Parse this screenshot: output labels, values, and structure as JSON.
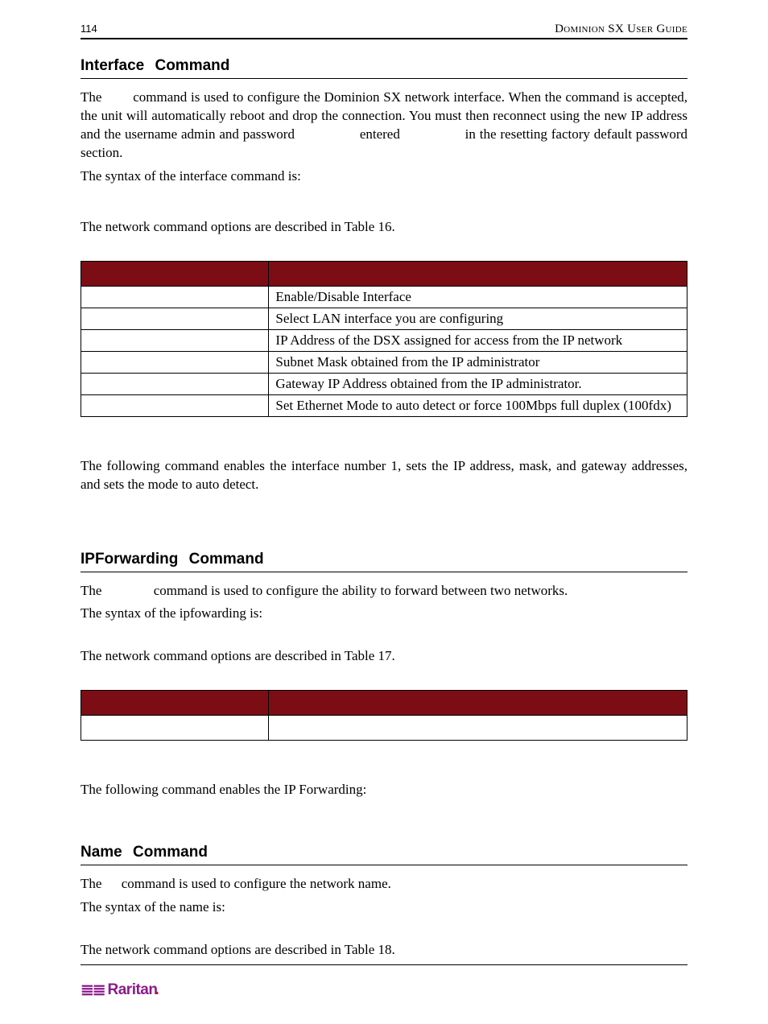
{
  "header": {
    "page_number": "114",
    "doc_title": "Dominion SX User Guide"
  },
  "section1": {
    "heading": "Interface Command",
    "p1_a": "The",
    "p1_b": "command is used to configure the Dominion SX network interface. When the command is accepted, the unit will automatically reboot and drop the connection. You must then reconnect using the new IP address and the username admin and password",
    "p1_c": "entered in",
    "p1_d": "the resetting factory default password section.",
    "p2": "The syntax of the interface command is:",
    "p3": "The network command options are described in Table 16.",
    "table": {
      "rows": [
        {
          "left": "",
          "right": "Enable/Disable Interface"
        },
        {
          "left": "",
          "right": "Select LAN interface you are configuring"
        },
        {
          "left": "",
          "right": "IP Address of the DSX assigned for access from the IP network"
        },
        {
          "left": "",
          "right": "Subnet Mask obtained from the IP administrator"
        },
        {
          "left": "",
          "right": "Gateway IP Address obtained from the IP administrator."
        },
        {
          "left": "",
          "right": "Set Ethernet Mode to auto detect or force 100Mbps full duplex (100fdx)"
        }
      ]
    },
    "p4": "The following command enables the interface number 1, sets the IP address, mask, and gateway addresses, and sets the mode to auto detect."
  },
  "section2": {
    "heading": "IPForwarding Command",
    "p1_a": "The",
    "p1_b": "command is used to configure the ability to forward between two networks.",
    "p2": "The syntax of the ipfowarding is:",
    "p3": "The network command options are described in Table 17.",
    "p4": "The following command enables the IP Forwarding:"
  },
  "section3": {
    "heading": "Name Command",
    "p1_a": "The",
    "p1_b": "command is used to configure the network name.",
    "p2": "The syntax of the name is:",
    "p3": "The network command options are described in Table 18."
  },
  "footer": {
    "brand": "Raritan"
  }
}
